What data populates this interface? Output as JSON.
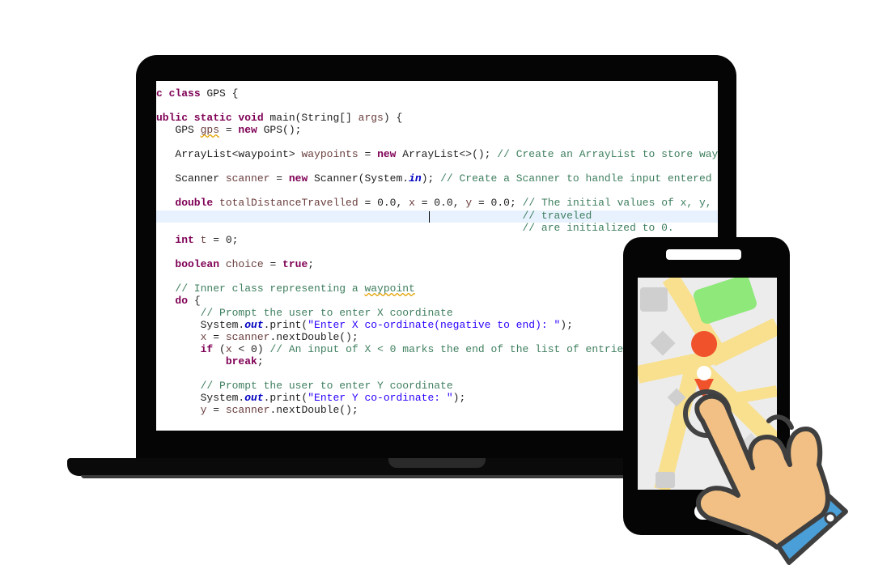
{
  "code_lines": [
    {
      "id": "line-class-decl",
      "parts": [
        {
          "t": "c ",
          "c": "kw"
        },
        {
          "t": "class",
          "c": "kw"
        },
        {
          "t": " GPS {"
        }
      ]
    },
    {
      "id": "line-main-decl",
      "parts": [
        {
          "t": "ublic static void",
          "c": "kw"
        },
        {
          "t": " main(String[] "
        },
        {
          "t": "args",
          "c": "vr"
        },
        {
          "t": ") {"
        }
      ]
    },
    {
      "id": "line-gps-init",
      "parts": [
        {
          "t": "   GPS "
        },
        {
          "t": "gps",
          "c": "vr sq"
        },
        {
          "t": " = "
        },
        {
          "t": "new",
          "c": "kw"
        },
        {
          "t": " GPS();"
        }
      ]
    },
    {
      "id": "line-arraylist",
      "parts": [
        {
          "t": "   ArrayList<waypoint> "
        },
        {
          "t": "waypoints",
          "c": "vr"
        },
        {
          "t": " = "
        },
        {
          "t": "new",
          "c": "kw"
        },
        {
          "t": " ArrayList<>(); "
        },
        {
          "t": "// Create an ArrayList to store way",
          "c": "cm"
        }
      ]
    },
    {
      "id": "line-scanner",
      "parts": [
        {
          "t": "   Scanner "
        },
        {
          "t": "scanner",
          "c": "vr"
        },
        {
          "t": " = "
        },
        {
          "t": "new",
          "c": "kw"
        },
        {
          "t": " Scanner(System."
        },
        {
          "t": "in",
          "c": "fld"
        },
        {
          "t": "); "
        },
        {
          "t": "// Create a Scanner to handle input entered",
          "c": "cm"
        }
      ]
    },
    {
      "id": "line-double",
      "parts": [
        {
          "t": "   "
        },
        {
          "t": "double",
          "c": "kw"
        },
        {
          "t": " "
        },
        {
          "t": "totalDistanceTravelled",
          "c": "vr"
        },
        {
          "t": " = 0.0, "
        },
        {
          "t": "x",
          "c": "vr"
        },
        {
          "t": " = 0.0, "
        },
        {
          "t": "y",
          "c": "vr"
        },
        {
          "t": " = 0.0; "
        },
        {
          "t": "// The initial values of x, y,",
          "c": "cm"
        }
      ]
    },
    {
      "id": "line-comment-traveled",
      "parts": [
        {
          "t": "                                                          "
        },
        {
          "t": "// traveled",
          "c": "cm"
        }
      ]
    },
    {
      "id": "line-comment-init",
      "parts": [
        {
          "t": "                                                          "
        },
        {
          "t": "// are initialized to 0.",
          "c": "cm"
        }
      ]
    },
    {
      "id": "line-int-t",
      "parts": [
        {
          "t": "   "
        },
        {
          "t": "int",
          "c": "kw"
        },
        {
          "t": " "
        },
        {
          "t": "t",
          "c": "vr"
        },
        {
          "t": " = 0;"
        }
      ]
    },
    {
      "id": "line-boolean",
      "parts": [
        {
          "t": "   "
        },
        {
          "t": "boolean",
          "c": "kw"
        },
        {
          "t": " "
        },
        {
          "t": "choice",
          "c": "vr"
        },
        {
          "t": " = "
        },
        {
          "t": "true",
          "c": "kw"
        },
        {
          "t": ";"
        }
      ]
    },
    {
      "id": "line-inner-comment",
      "parts": [
        {
          "t": "   "
        },
        {
          "t": "// Inner class representing a ",
          "c": "cm"
        },
        {
          "t": "waypoint",
          "c": "cm sq"
        }
      ]
    },
    {
      "id": "line-do",
      "parts": [
        {
          "t": "   "
        },
        {
          "t": "do",
          "c": "kw"
        },
        {
          "t": " {"
        }
      ]
    },
    {
      "id": "line-prompt-x",
      "parts": [
        {
          "t": "       "
        },
        {
          "t": "// Prompt the user to enter X coordinate",
          "c": "cm"
        }
      ]
    },
    {
      "id": "line-print-x",
      "parts": [
        {
          "t": "       System."
        },
        {
          "t": "out",
          "c": "fld"
        },
        {
          "t": ".print("
        },
        {
          "t": "\"Enter X co-ordinate(negative to end): \"",
          "c": "st"
        },
        {
          "t": ");"
        }
      ]
    },
    {
      "id": "line-read-x",
      "parts": [
        {
          "t": "       "
        },
        {
          "t": "x",
          "c": "vr"
        },
        {
          "t": " = "
        },
        {
          "t": "scanner",
          "c": "vr"
        },
        {
          "t": ".nextDouble();"
        }
      ]
    },
    {
      "id": "line-if",
      "parts": [
        {
          "t": "       "
        },
        {
          "t": "if",
          "c": "kw"
        },
        {
          "t": " ("
        },
        {
          "t": "x",
          "c": "vr"
        },
        {
          "t": " < 0) "
        },
        {
          "t": "// An input of X < 0 marks the end of the list of entrie",
          "c": "cm"
        }
      ]
    },
    {
      "id": "line-break",
      "parts": [
        {
          "t": "           "
        },
        {
          "t": "break",
          "c": "kw"
        },
        {
          "t": ";"
        }
      ]
    },
    {
      "id": "line-prompt-y",
      "parts": [
        {
          "t": "       "
        },
        {
          "t": "// Prompt the user to enter Y coordinate",
          "c": "cm"
        }
      ]
    },
    {
      "id": "line-print-y",
      "parts": [
        {
          "t": "       System."
        },
        {
          "t": "out",
          "c": "fld"
        },
        {
          "t": ".print("
        },
        {
          "t": "\"Enter Y co-ordinate: \"",
          "c": "st"
        },
        {
          "t": ");"
        }
      ]
    },
    {
      "id": "line-read-y",
      "parts": [
        {
          "t": "       "
        },
        {
          "t": "y",
          "c": "vr"
        },
        {
          "t": " = "
        },
        {
          "t": "scanner",
          "c": "vr"
        },
        {
          "t": ".nextDouble();"
        }
      ]
    }
  ],
  "colors": {
    "keyword": "#7f0055",
    "comment": "#3f7f5f",
    "string": "#2a00ff",
    "variable": "#6a3e3e",
    "field": "#0000c0",
    "line_highlight": "#e8f2fe",
    "map_road": "#f8e08e",
    "map_park": "#8ee87a",
    "map_pin": "#f0532c",
    "hand_skin": "#f2c084",
    "cuff": "#4a9fd8"
  },
  "icons": {
    "phone_map": "map-icon",
    "location_pin": "location-pin-icon",
    "tap_gesture": "pointing-hand-icon"
  }
}
